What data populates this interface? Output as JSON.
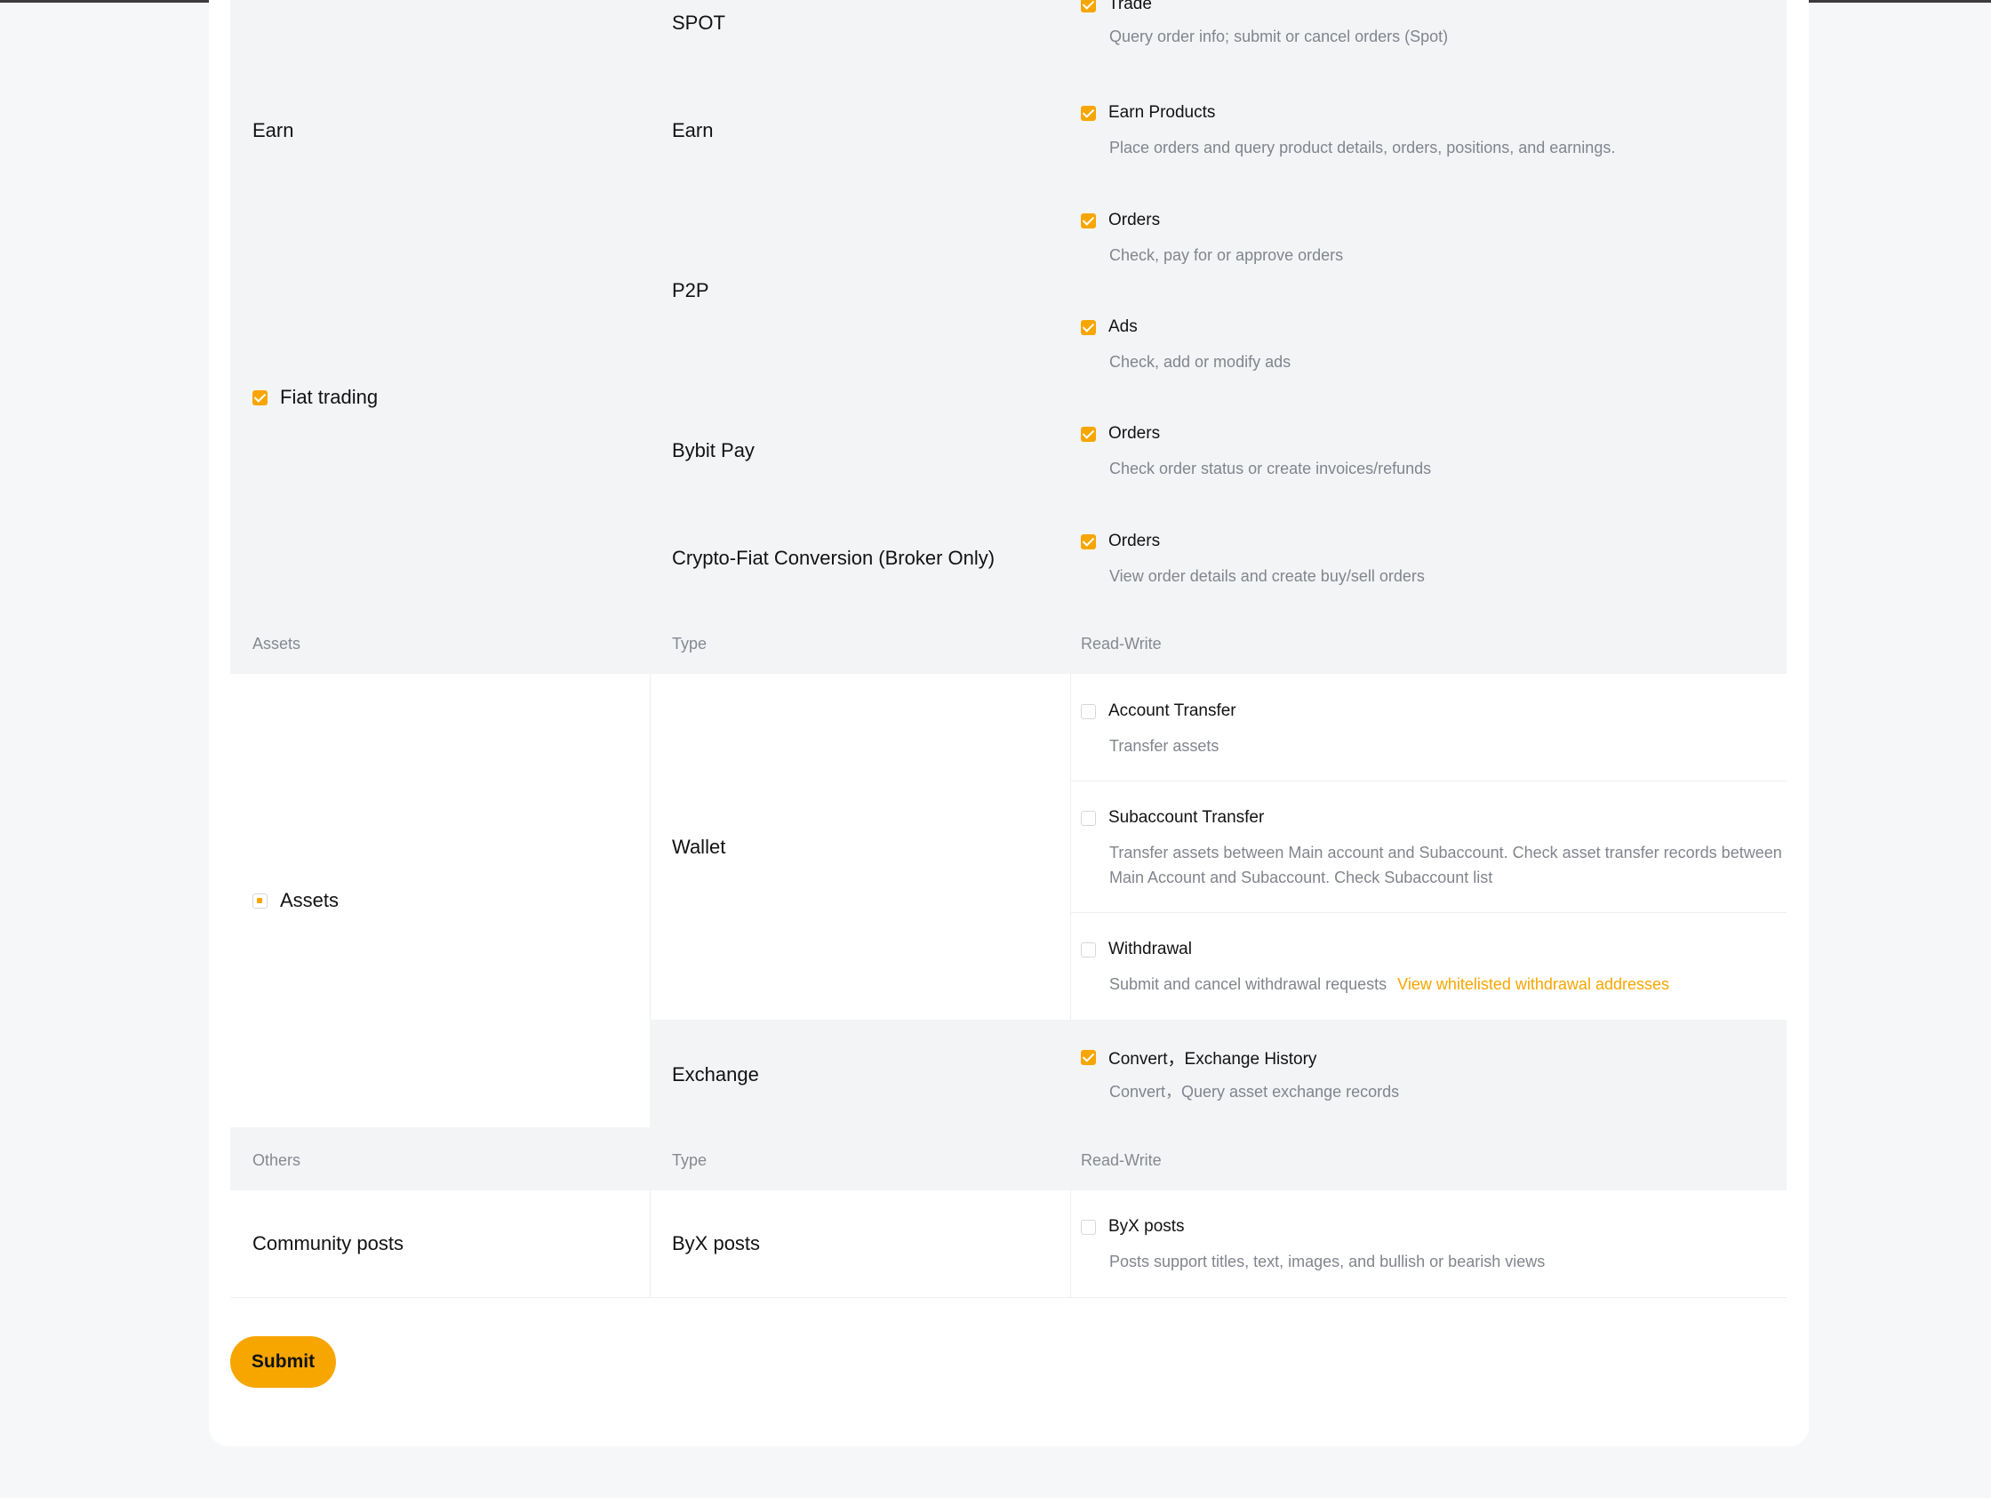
{
  "trade_section": {
    "spot": {
      "type": "SPOT",
      "perms": [
        {
          "title": "Trade",
          "desc": "Query order info; submit or cancel orders (Spot)",
          "checked": true
        }
      ]
    },
    "earn": {
      "category": "Earn",
      "type": "Earn",
      "perms": [
        {
          "title": "Earn Products",
          "desc": "Place orders and query product details, orders, positions, and earnings.",
          "checked": true
        }
      ]
    },
    "fiat": {
      "category": "Fiat trading",
      "checked": true,
      "p2p": {
        "type": "P2P",
        "perms": [
          {
            "title": "Orders",
            "desc": "Check, pay for or approve orders",
            "checked": true
          },
          {
            "title": "Ads",
            "desc": "Check, add or modify ads",
            "checked": true
          }
        ]
      },
      "bybit_pay": {
        "type": "Bybit Pay",
        "perms": [
          {
            "title": "Orders",
            "desc": "Check order status or create invoices/refunds",
            "checked": true
          }
        ]
      },
      "conversion": {
        "type": "Crypto-Fiat Conversion (Broker Only)",
        "perms": [
          {
            "title": "Orders",
            "desc": "View order details and create buy/sell orders",
            "checked": true
          }
        ]
      }
    }
  },
  "assets_section": {
    "header": {
      "col1": "Assets",
      "col2": "Type",
      "col3": "Read-Write"
    },
    "category": "Assets",
    "state": "partial",
    "wallet": {
      "type": "Wallet",
      "perms": [
        {
          "title": "Account Transfer",
          "desc": "Transfer assets",
          "checked": false
        },
        {
          "title": "Subaccount Transfer",
          "desc": "Transfer assets between Main account and Subaccount. Check asset transfer records between Main Account and Subaccount. Check Subaccount list",
          "checked": false
        },
        {
          "title": "Withdrawal",
          "desc": "Submit and cancel withdrawal requests",
          "link": "View whitelisted withdrawal addresses",
          "checked": false
        }
      ]
    },
    "exchange": {
      "type": "Exchange",
      "perms": [
        {
          "title": "Convert，Exchange History",
          "desc": "Convert，Query asset exchange records",
          "checked": true
        }
      ]
    }
  },
  "others_section": {
    "header": {
      "col1": "Others",
      "col2": "Type",
      "col3": "Read-Write"
    },
    "category": "Community posts",
    "type": "ByX posts",
    "perms": [
      {
        "title": "ByX posts",
        "desc": "Posts support titles, text, images, and bullish or bearish views",
        "checked": false
      }
    ]
  },
  "submit_label": "Submit",
  "colors": {
    "accent": "#f7a600",
    "section_bg": "#f3f4f6",
    "page_bg": "#f6f7f9"
  }
}
